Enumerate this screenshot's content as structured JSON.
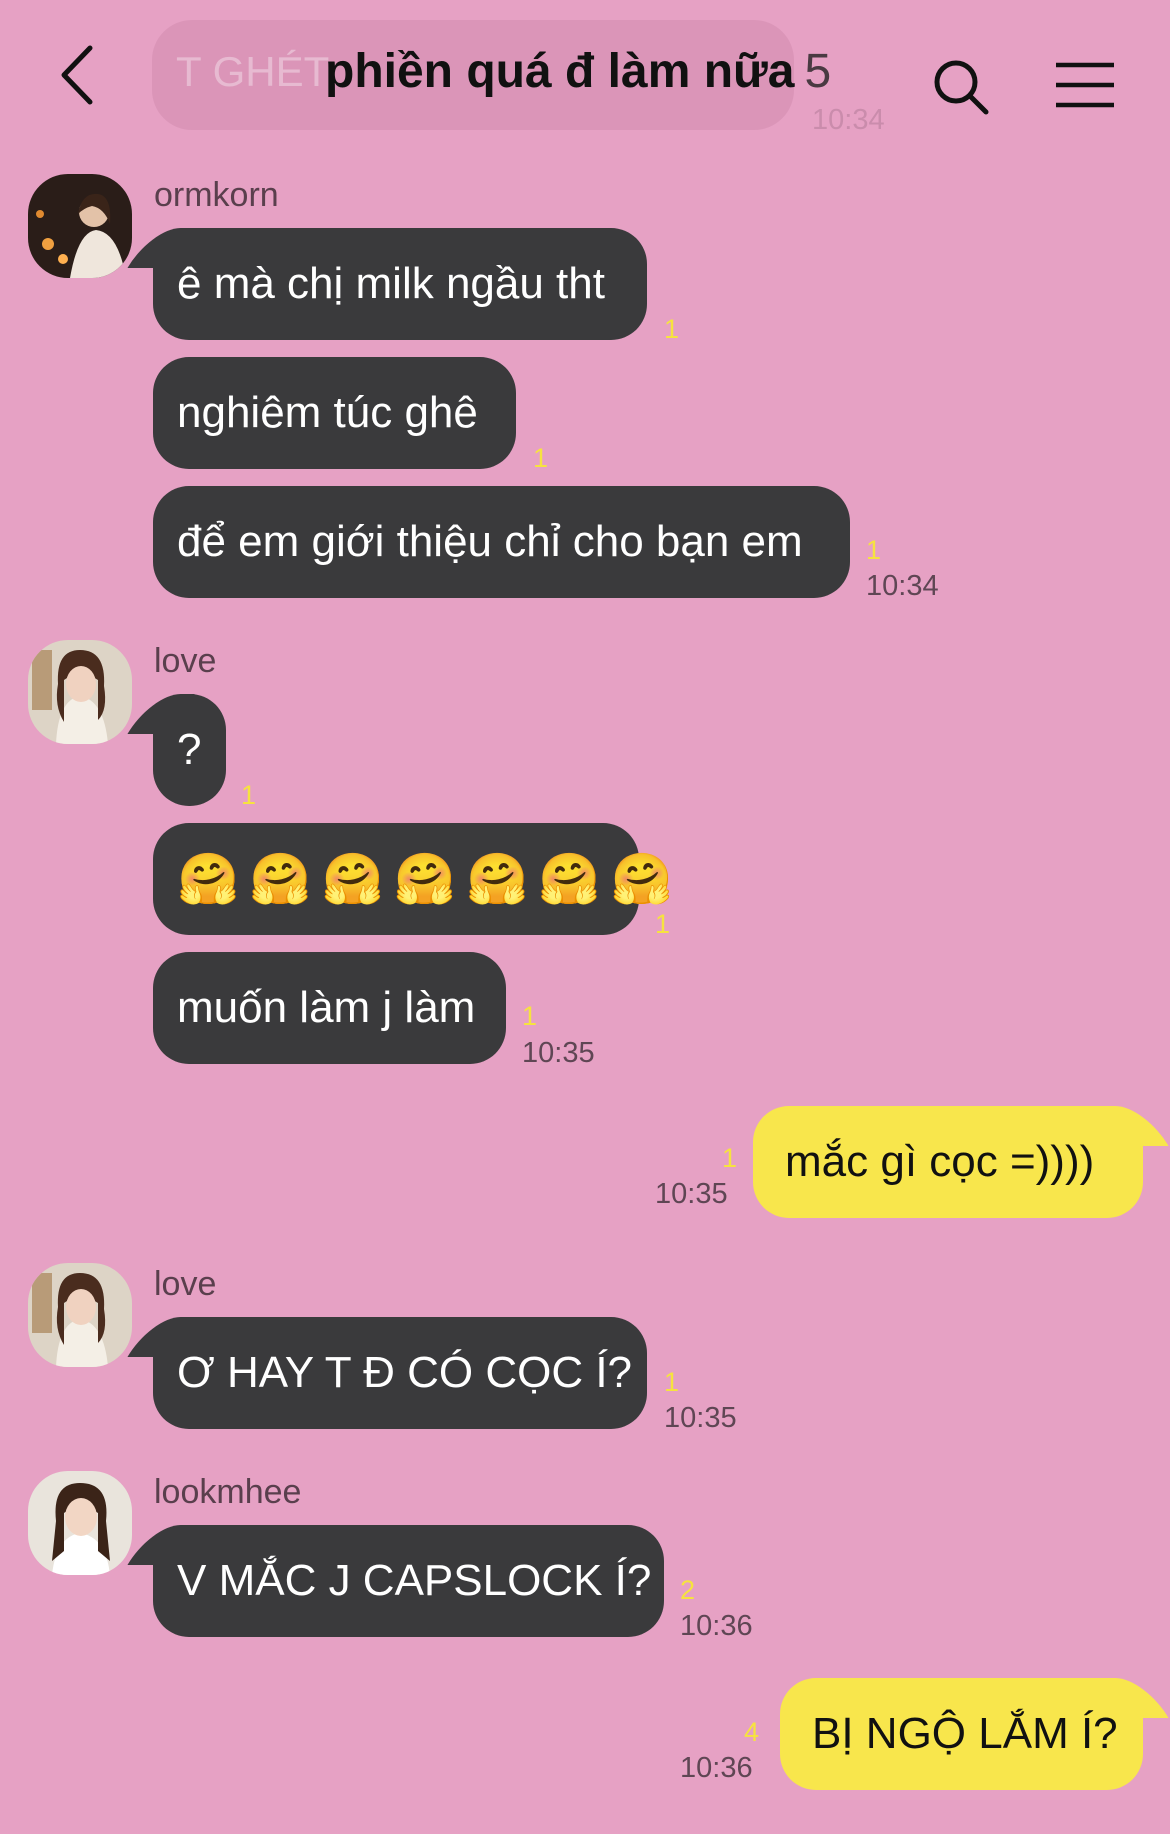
{
  "header": {
    "title": "phiền quá đ làm nữa",
    "member_count": "5",
    "back_icon": "chevron-left-icon",
    "search_icon": "search-icon",
    "menu_icon": "hamburger-menu-icon",
    "ghost_text": "T GHÉT",
    "ghost_time": "10:34"
  },
  "colors": {
    "background": "#e6a1c4",
    "incoming": "#3a3a3c",
    "outgoing": "#f8e64c",
    "unread": "#f6e33f"
  },
  "messages": [
    {
      "sender": "ormkorn",
      "text": "ê mà chị milk ngầu tht",
      "unread": "1"
    },
    {
      "text": "nghiêm túc ghê",
      "unread": "1"
    },
    {
      "text": "để em giới thiệu chỉ cho bạn em",
      "unread": "1",
      "time": "10:34"
    },
    {
      "sender": "love",
      "text": "?",
      "unread": "1"
    },
    {
      "emojis": [
        "🤗",
        "🤗",
        "🤗",
        "🤗",
        "🤗",
        "🤗",
        "🤗"
      ],
      "unread": "1"
    },
    {
      "text": "muốn làm j làm",
      "unread": "1",
      "time": "10:35"
    },
    {
      "text": "mắc gì cọc =))))",
      "unread": "1",
      "time": "10:35"
    },
    {
      "sender": "love",
      "text": "Ơ HAY T Đ CÓ CỌC Í?",
      "unread": "1",
      "time": "10:35"
    },
    {
      "sender": "lookmhee",
      "text": "V MẮC J CAPSLOCK Í?",
      "unread": "2",
      "time": "10:36"
    },
    {
      "text": "BỊ NGỘ LẮM Í?",
      "unread": "4",
      "time": "10:36"
    }
  ]
}
